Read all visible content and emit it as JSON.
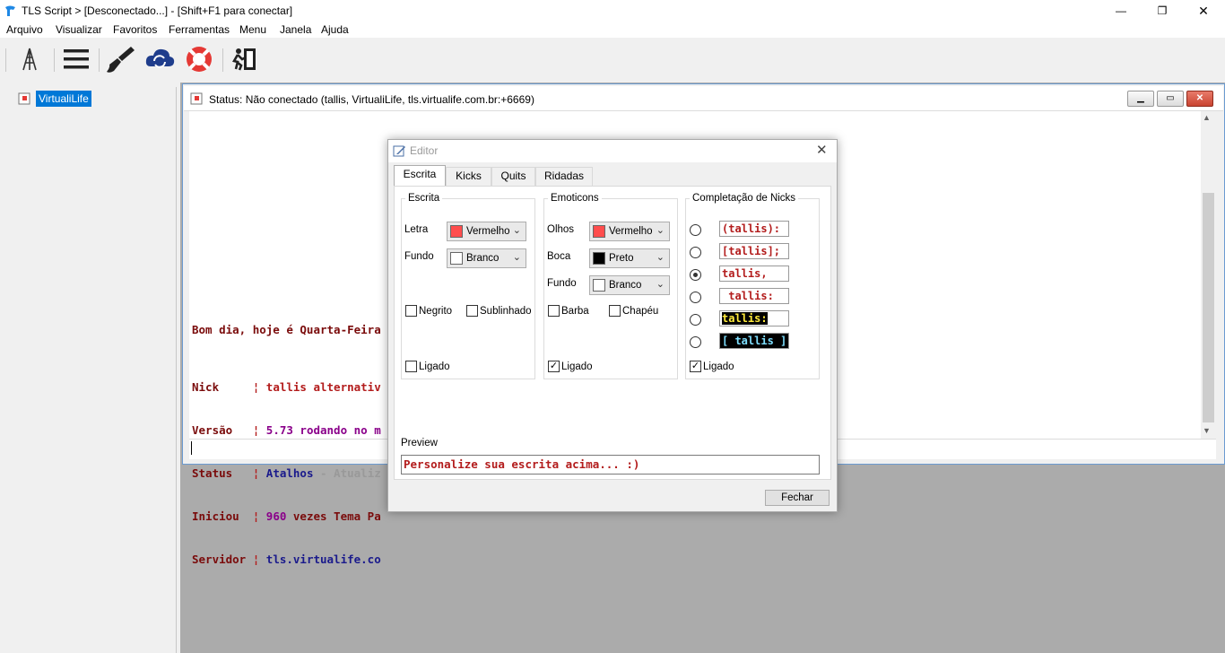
{
  "app": {
    "title": "TLS Script > [Desconectado...] - [Shift+F1 para conectar]",
    "minimize": "—",
    "restore": "❐",
    "close": "✕"
  },
  "menu": [
    "Arquivo",
    "Visualizar",
    "Favoritos",
    "Ferramentas",
    "Menu",
    "Janela",
    "Ajuda"
  ],
  "toolbar": [
    "antenna-icon",
    "menu-lines-icon",
    "brush-icon",
    "cloud-sync-icon",
    "lifebuoy-icon",
    "exit-run-icon"
  ],
  "tree": {
    "server": "VirtualiLife"
  },
  "status_window": {
    "title": "Status: Não conectado (tallis, VirtualiLife, tls.virtualife.com.br:+6669)"
  },
  "chat": {
    "greeting": "Bom dia, hoje é Quarta-Feira",
    "rows": [
      {
        "key": "Nick    ",
        "sep": " ¦ ",
        "val": "tallis alternativ",
        "extra": ""
      },
      {
        "key": "Versão  ",
        "sep": " ¦ ",
        "val": "5.73 rodando no m",
        "extra": ""
      },
      {
        "key": "Status  ",
        "sep": " ¦ ",
        "val": "Atalhos",
        "extra": " - Atualiz"
      },
      {
        "key": "Iniciou ",
        "sep": " ¦ ",
        "val": "960",
        "extra": " vezes Tema Pa"
      },
      {
        "key": "Servidor",
        "sep": " ¦ ",
        "val": "tls.virtualife.co",
        "extra": ""
      }
    ]
  },
  "editor": {
    "title": "Editor",
    "tabs": [
      "Escrita",
      "Kicks",
      "Quits",
      "Ridadas"
    ],
    "escrita": {
      "label": "Escrita",
      "letra_label": "Letra",
      "letra_value": "Vermelho",
      "fundo_label": "Fundo",
      "fundo_value": "Branco",
      "negrito": "Negrito",
      "sublinhado": "Sublinhado",
      "ligado": "Ligado"
    },
    "emoticons": {
      "label": "Emoticons",
      "olhos_label": "Olhos",
      "olhos_value": "Vermelho",
      "boca_label": "Boca",
      "boca_value": "Preto",
      "fundo_label": "Fundo",
      "fundo_value": "Branco",
      "barba": "Barba",
      "chapeu": "Chapéu",
      "ligado": "Ligado"
    },
    "nicks": {
      "label": "Completação de Nicks",
      "options": [
        "(tallis):",
        "[tallis];",
        "tallis,",
        " tallis:",
        "tallis:",
        "[ tallis ]"
      ],
      "ligado": "Ligado"
    },
    "preview_label": "Preview",
    "preview_text": "Personalize sua escrita acima... :)",
    "close_button": "Fechar"
  },
  "colors": {
    "accent": "#0078d7",
    "red": "#ff4d4d",
    "chat_key": "#7a0b0b",
    "chat_val": "#b31c1c",
    "chat_num": "#8a008a",
    "chat_blue": "#1a1a8c"
  }
}
